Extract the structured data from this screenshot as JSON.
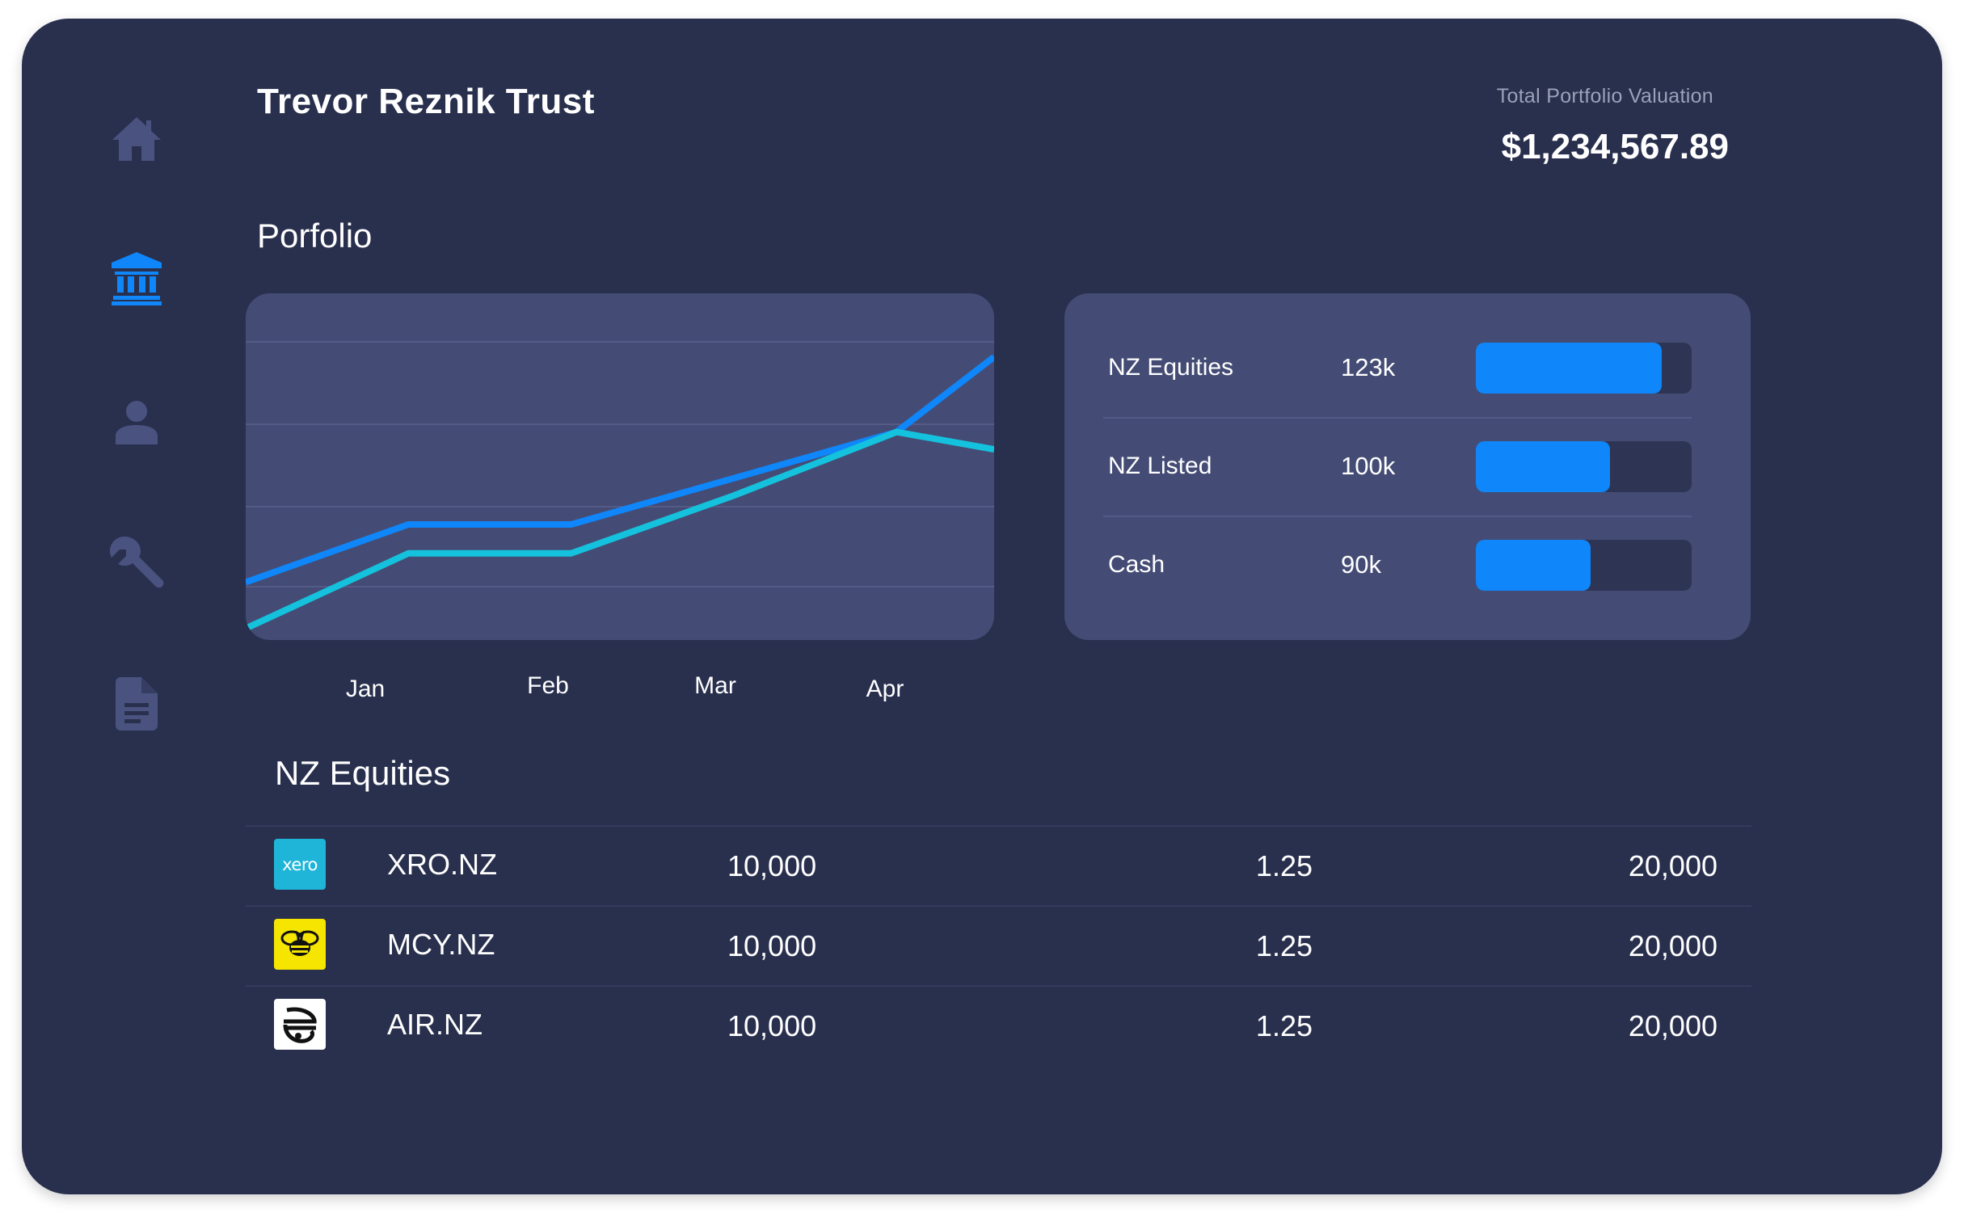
{
  "header": {
    "title": "Trevor Reznik Trust",
    "valuation_label": "Total Portfolio Valuation",
    "valuation_amount": "$1,234,567.89"
  },
  "sidebar": {
    "items": [
      {
        "name": "home",
        "icon": "home-icon",
        "active": false
      },
      {
        "name": "bank",
        "icon": "bank-icon",
        "active": true
      },
      {
        "name": "profile",
        "icon": "user-icon",
        "active": false
      },
      {
        "name": "settings",
        "icon": "wrench-icon",
        "active": false
      },
      {
        "name": "documents",
        "icon": "document-icon",
        "active": false
      }
    ],
    "active_color": "#0f86f9",
    "inactive_color": "#4a5380"
  },
  "portfolio": {
    "section_title": "Porfolio"
  },
  "chart_data": {
    "type": "line",
    "categories": [
      "Jan",
      "Feb",
      "Mar",
      "Apr"
    ],
    "series": [
      {
        "color": "#0f86f9",
        "values": [
          1.0,
          2.0,
          2.0,
          2.8,
          3.6,
          4.9
        ]
      },
      {
        "color": "#14c2dd",
        "values": [
          0.2,
          1.5,
          1.5,
          2.5,
          3.6,
          3.3
        ]
      }
    ],
    "x": [
      0,
      1,
      2,
      3,
      4,
      4.6
    ],
    "ylim": [
      0,
      6
    ],
    "grid": true,
    "xlabel": "",
    "ylabel": ""
  },
  "allocation": {
    "rows": [
      {
        "name": "NZ Equities",
        "value": "123k",
        "fraction": 0.86
      },
      {
        "name": "NZ Listed",
        "value": "100k",
        "fraction": 0.62
      },
      {
        "name": "Cash",
        "value": "90k",
        "fraction": 0.53
      }
    ],
    "bar_color": "#0f86f9"
  },
  "equities": {
    "section_title": "NZ Equities",
    "rows": [
      {
        "logo": "xero-logo",
        "logo_text": "xero",
        "ticker": "XRO.NZ",
        "quantity": "10,000",
        "price": "1.25",
        "total": "20,000"
      },
      {
        "logo": "mercury-bee-logo",
        "ticker": "MCY.NZ",
        "quantity": "10,000",
        "price": "1.25",
        "total": "20,000"
      },
      {
        "logo": "air-nz-koru-logo",
        "ticker": "AIR.NZ",
        "quantity": "10,000",
        "price": "1.25",
        "total": "20,000"
      }
    ]
  }
}
